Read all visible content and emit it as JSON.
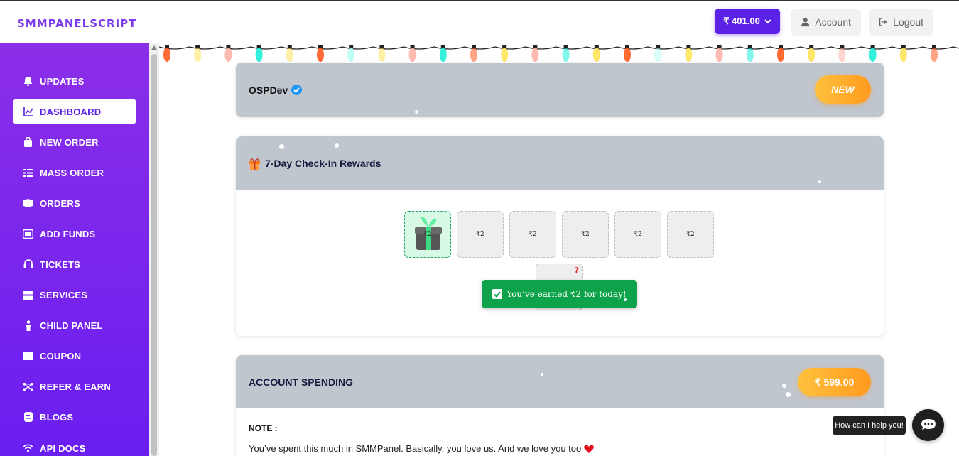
{
  "brand": {
    "logo_text": "SMMPANELSCRIPT"
  },
  "header": {
    "balance": "₹ 401.00",
    "account_label": "Account",
    "logout_label": "Logout"
  },
  "sidebar": {
    "items": [
      {
        "label": "UPDATES",
        "icon": "bell-icon",
        "active": false
      },
      {
        "label": "DASHBOARD",
        "icon": "chart-line-icon",
        "active": true
      },
      {
        "label": "NEW ORDER",
        "icon": "shopping-bag-icon",
        "active": false
      },
      {
        "label": "MASS ORDER",
        "icon": "list-icon",
        "active": false
      },
      {
        "label": "ORDERS",
        "icon": "boxes-icon",
        "active": false
      },
      {
        "label": "ADD FUNDS",
        "icon": "wallet-icon",
        "active": false
      },
      {
        "label": "TICKETS",
        "icon": "headset-icon",
        "active": false
      },
      {
        "label": "SERVICES",
        "icon": "server-icon",
        "active": false
      },
      {
        "label": "CHILD PANEL",
        "icon": "child-icon",
        "active": false
      },
      {
        "label": "COUPON",
        "icon": "ticket-icon",
        "active": false
      },
      {
        "label": "REFER & EARN",
        "icon": "network-icon",
        "active": false
      },
      {
        "label": "BLOGS",
        "icon": "blog-icon",
        "active": false
      },
      {
        "label": "API DOCS",
        "icon": "wifi-icon",
        "active": false
      }
    ]
  },
  "profile_card": {
    "username": "OSPDev",
    "badge": "NEW"
  },
  "rewards_card": {
    "title": "7-Day Check-In Rewards",
    "days": [
      "₹2",
      "₹2",
      "₹2",
      "₹2",
      "₹2",
      "₹2"
    ],
    "day7_mark": "?",
    "toast": "You’ve earned ₹2 for today!"
  },
  "spending_card": {
    "title": "ACCOUNT SPENDING",
    "amount": "₹ 599.00",
    "note_label": "NOTE :",
    "note_text": "You’ve spent this much in SMMPanel. Basically, you love us. And we love you too"
  },
  "chat": {
    "tooltip": "How can I help you!"
  },
  "colors": {
    "primary": "#5b21e6",
    "sidebar_top": "#8b2ee8",
    "badge": "#ff9a1f",
    "success": "#0ea34a"
  }
}
